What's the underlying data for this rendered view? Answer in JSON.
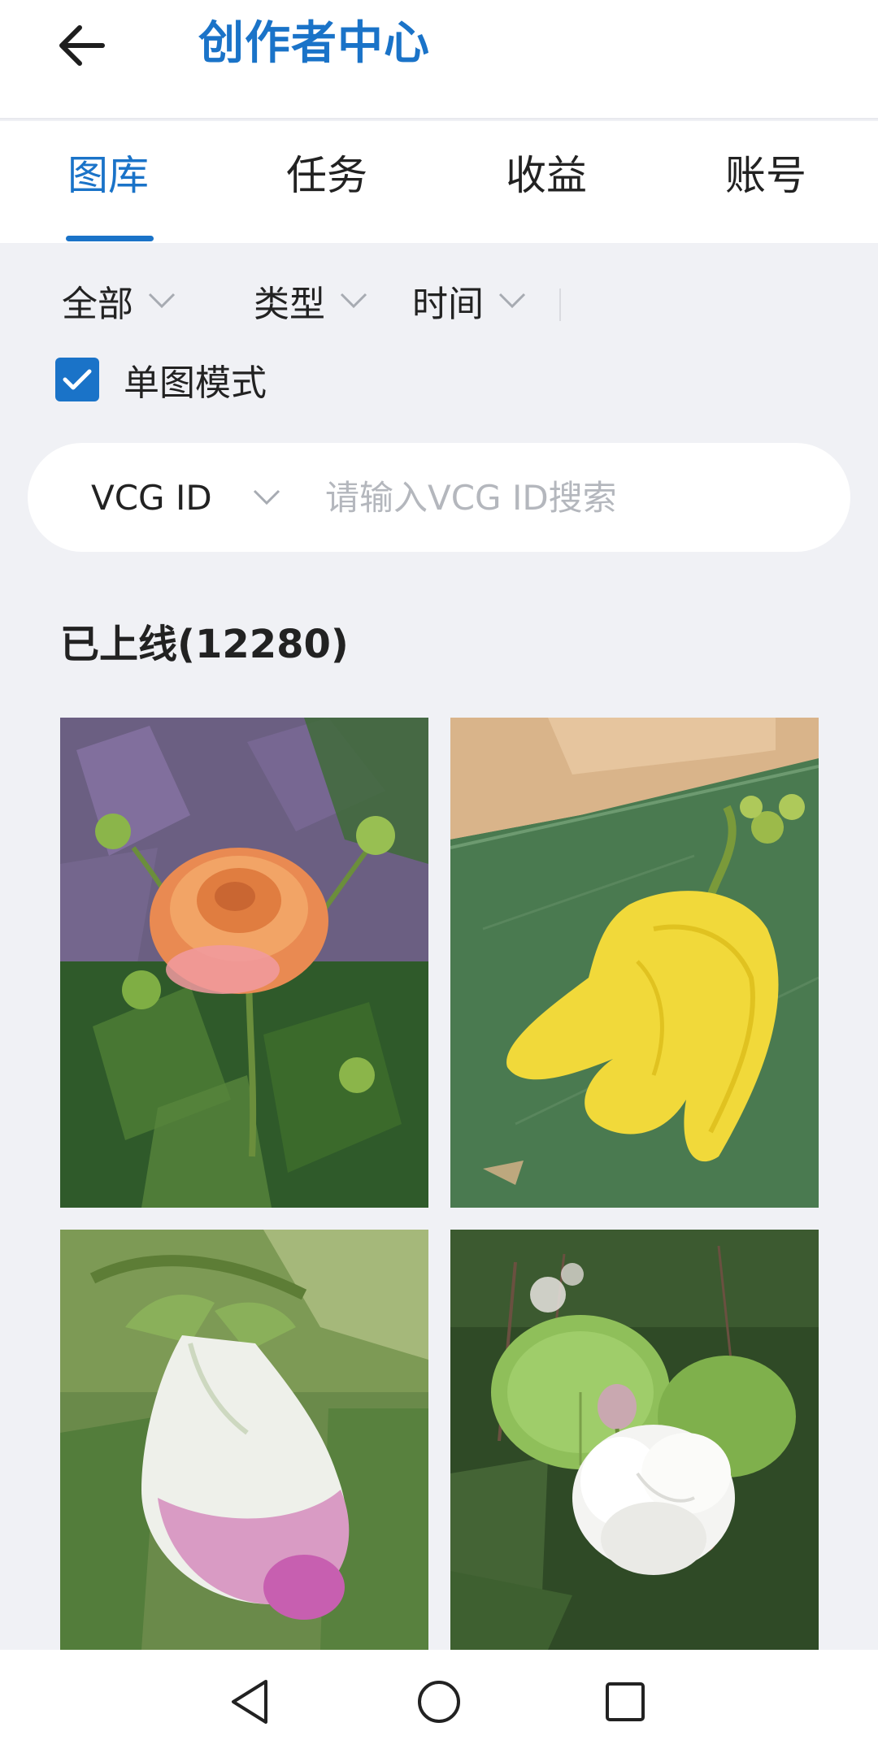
{
  "header": {
    "title": "创作者中心",
    "back_icon": "arrow-left-icon",
    "accent_color": "#1a73c8"
  },
  "tabs": [
    {
      "label": "图库",
      "active": true
    },
    {
      "label": "任务",
      "active": false
    },
    {
      "label": "收益",
      "active": false
    },
    {
      "label": "账号",
      "active": false
    }
  ],
  "filters": [
    {
      "label": "全部",
      "icon": "chevron-down-icon"
    },
    {
      "label": "类型",
      "icon": "chevron-down-icon"
    },
    {
      "label": "时间",
      "icon": "chevron-down-icon"
    }
  ],
  "single_mode": {
    "label": "单图模式",
    "checked": true
  },
  "search": {
    "type_label": "VCG ID",
    "type_icon": "chevron-down-icon",
    "placeholder": "请输入VCG ID搜索",
    "value": ""
  },
  "gallery": {
    "section_title": "已上线(12280)",
    "photos": [
      {
        "subject": "orange-rose-photo"
      },
      {
        "subject": "yellow-flower-photo"
      },
      {
        "subject": "pink-white-bud-photo"
      },
      {
        "subject": "white-jasmine-photo"
      }
    ]
  },
  "nav": {
    "back_icon": "nav-back-triangle-icon",
    "home_icon": "nav-home-circle-icon",
    "recents_icon": "nav-recents-square-icon"
  }
}
